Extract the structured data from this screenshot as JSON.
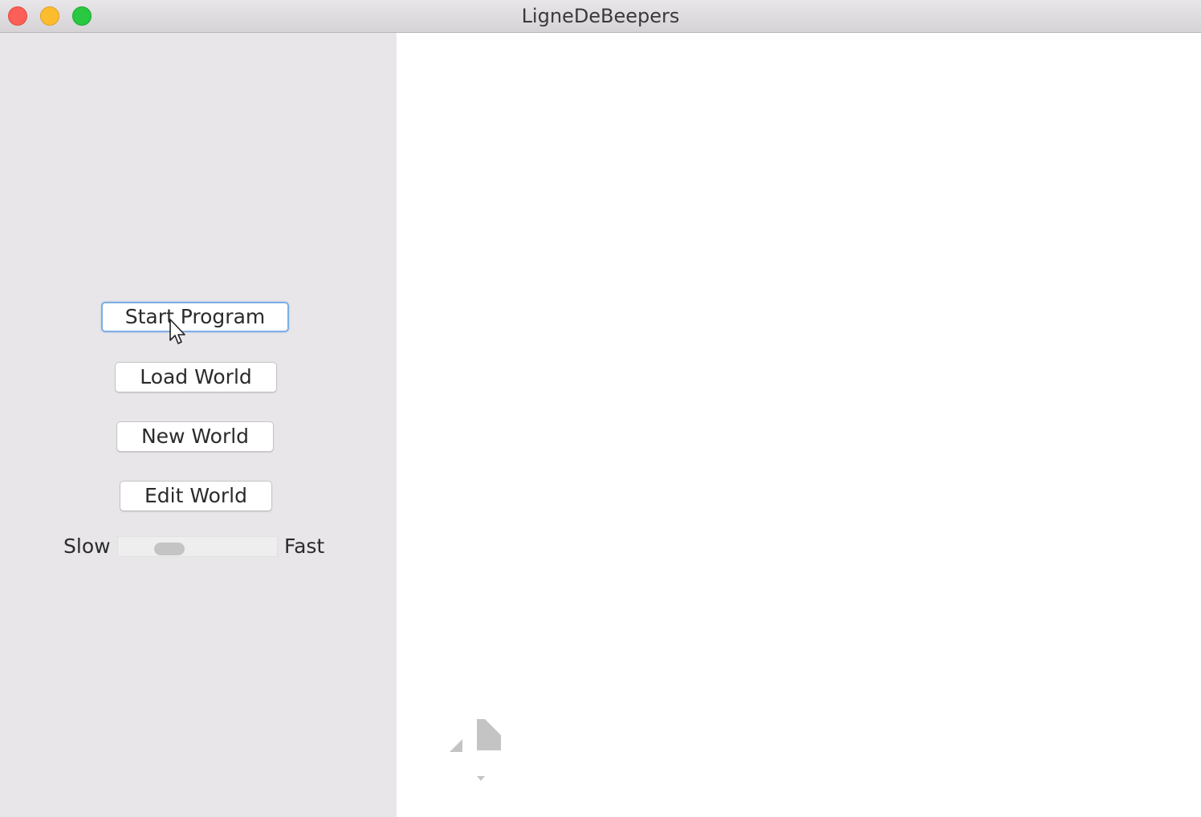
{
  "window": {
    "title": "LigneDeBeepers"
  },
  "controls": {
    "start_program": "Start Program",
    "load_world": "Load World",
    "new_world": "New World",
    "edit_world": "Edit World"
  },
  "speed": {
    "slow_label": "Slow",
    "fast_label": "Fast",
    "value": 0.23
  },
  "icons": {
    "close": "close-icon",
    "minimize": "minimize-icon",
    "maximize": "maximize-icon",
    "cursor": "mouse-pointer-icon",
    "robot": "karel-robot-icon"
  },
  "colors": {
    "sidebar_bg": "#e8e6e9",
    "canvas_bg": "#ffffff",
    "focus_ring": "#7eaee4",
    "close": "#fc5f57",
    "minimize": "#fdbc2e",
    "maximize": "#28c840"
  }
}
